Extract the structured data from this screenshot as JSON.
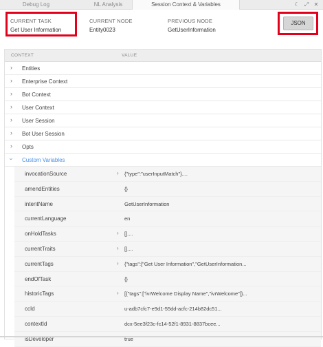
{
  "tabs": {
    "debug_log": "Debug Log",
    "nl_analysis": "NL Analysis",
    "session_context": "Session Context & Variables"
  },
  "header": {
    "current_task_label": "CURRENT TASK",
    "current_task_value": "Get User Information",
    "current_node_label": "CURRENT NODE",
    "current_node_value": "Entity0023",
    "previous_node_label": "PREVIOUS NODE",
    "previous_node_value": "GetUserInformation",
    "json_button": "JSON"
  },
  "table": {
    "col_context": "CONTEXT",
    "col_value": "VALUE",
    "sections": [
      {
        "label": "Entities"
      },
      {
        "label": "Enterprise Context"
      },
      {
        "label": "Bot Context"
      },
      {
        "label": "User Context"
      },
      {
        "label": "User Session"
      },
      {
        "label": "Bot User Session"
      },
      {
        "label": "Opts"
      },
      {
        "label": "Custom Variables"
      }
    ],
    "custom_variables": [
      {
        "key": "invocationSource",
        "value": "{\"type\":\"userInputMatch\"}....",
        "expandable": true
      },
      {
        "key": "amendEntities",
        "value": "{}",
        "expandable": false
      },
      {
        "key": "intentName",
        "value": "GetUserInformation",
        "expandable": false
      },
      {
        "key": "currentLanguage",
        "value": "en",
        "expandable": false
      },
      {
        "key": "onHoldTasks",
        "value": "[]....",
        "expandable": true
      },
      {
        "key": "currentTraits",
        "value": "[]....",
        "expandable": true
      },
      {
        "key": "currentTags",
        "value": "{\"tags\":[\"Get User Information\",\"GetUserInformation...",
        "expandable": true
      },
      {
        "key": "endOfTask",
        "value": "{}",
        "expandable": false
      },
      {
        "key": "historicTags",
        "value": "[{\"tags\":[\"ivrWelcome Display Name\",\"ivrWelcome\"]}...",
        "expandable": true
      },
      {
        "key": "ccId",
        "value": "u-adb7cfc7-e9d1-55dd-acfc-214b82dc51...",
        "expandable": false
      },
      {
        "key": "contextId",
        "value": "dcx-5ee3f23c-fc14-52f1-8931-8837bcee...",
        "expandable": false
      },
      {
        "key": "isDeveloper",
        "value": "true",
        "expandable": false
      }
    ]
  },
  "colors": {
    "highlight_red": "#e3001b",
    "link_blue": "#4a8fe7"
  }
}
